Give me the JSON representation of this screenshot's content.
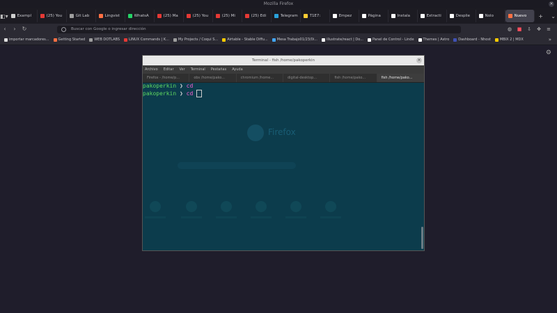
{
  "window": {
    "title": "Mozilla Firefox"
  },
  "tabs": [
    {
      "label": "Exampl",
      "color": "#cfcfcf"
    },
    {
      "label": "(25) You",
      "color": "#e53935"
    },
    {
      "label": "Git Lab",
      "color": "#9e9e9e"
    },
    {
      "label": "Lingvist",
      "color": "#ff7043"
    },
    {
      "label": "WhatsA",
      "color": "#25d366"
    },
    {
      "label": "(25) Ma",
      "color": "#e53935"
    },
    {
      "label": "(25) You",
      "color": "#e53935"
    },
    {
      "label": "(25) Mi",
      "color": "#e53935"
    },
    {
      "label": "(25) Edi",
      "color": "#e53935"
    },
    {
      "label": "Telegram",
      "color": "#2aa1da"
    },
    {
      "label": "T1E7: ",
      "color": "#ffcc33"
    },
    {
      "label": "Empez",
      "color": "#ffffff"
    },
    {
      "label": "Página",
      "color": "#ffffff"
    },
    {
      "label": "Instala",
      "color": "#ffffff"
    },
    {
      "label": "Extracti",
      "color": "#ffffff"
    },
    {
      "label": "Desplie",
      "color": "#ffffff"
    },
    {
      "label": "Nolo",
      "color": "#ffffff"
    },
    {
      "label": "Nuevo",
      "color": "#ff7043",
      "active": true
    }
  ],
  "navbar": {
    "url_placeholder": "Buscar con Google o ingresar dirección"
  },
  "bookmarks": [
    {
      "label": "importar marcadores...",
      "color": "#e0e0e0"
    },
    {
      "label": "Getting Started",
      "color": "#ff7043"
    },
    {
      "label": "WEB DOTLABS",
      "color": "#9e9e9e"
    },
    {
      "label": "LINUX Commands | K...",
      "color": "#e53935"
    },
    {
      "label": "My Projects / Coqui S...",
      "color": "#9e9e9e"
    },
    {
      "label": "Airtable - Stable Diffu...",
      "color": "#ffcc00"
    },
    {
      "label": "Mesa Trabajo01/23/0i...",
      "color": "#42a5f5"
    },
    {
      "label": "illustrate/react | Do...",
      "color": "#ffffff"
    },
    {
      "label": "Panel de Control - Linde",
      "color": "#ffffff"
    },
    {
      "label": "Themes | Astro",
      "color": "#ffffff"
    },
    {
      "label": "Dashboard - Nhost",
      "color": "#3f51b5"
    },
    {
      "label": "MBIX 2 | MDX",
      "color": "#ffcc00"
    }
  ],
  "terminal": {
    "title": "Terminal - fish /home/pakoperkin",
    "menu": [
      "Archivo",
      "Editar",
      "Ver",
      "Terminal",
      "Pestañas",
      "Ayuda"
    ],
    "tabs": [
      {
        "label": "Firefox - /home/p..."
      },
      {
        "label": "obs /home/pako..."
      },
      {
        "label": "chromium /home..."
      },
      {
        "label": "digital-desktop..."
      },
      {
        "label": "fish /home/pako..."
      },
      {
        "label": "fish /home/pako...",
        "active": true
      }
    ],
    "lines": [
      {
        "user": "pakoperkin",
        "arrow": "❯",
        "cmd": "cd"
      },
      {
        "user": "pakoperkin",
        "arrow": "❯",
        "cmd": "cd",
        "cursor": true
      }
    ]
  },
  "ghost": {
    "brand": "Firefox"
  }
}
